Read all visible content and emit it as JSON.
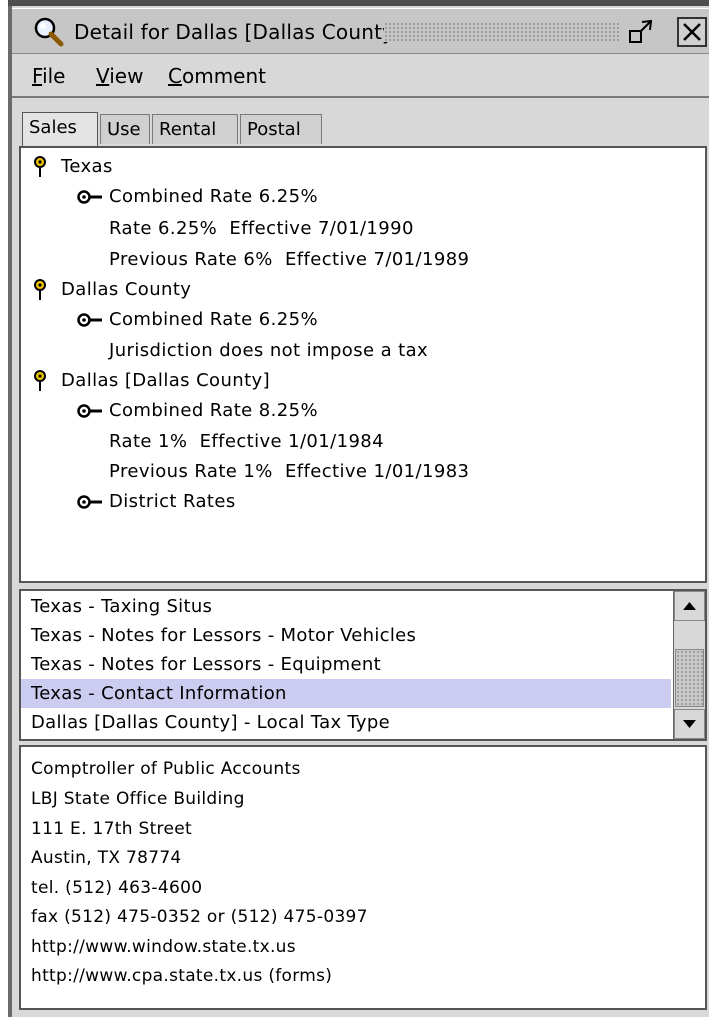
{
  "window": {
    "title": "Detail for Dallas [Dallas County]",
    "icon": "magnifier-icon",
    "buttons": [
      "restore-icon",
      "close-icon"
    ]
  },
  "menu": {
    "file": {
      "mnemonic": "F",
      "rest": "ile"
    },
    "view": {
      "mnemonic": "V",
      "rest": "iew"
    },
    "comment": {
      "mnemonic": "C",
      "rest": "omment"
    }
  },
  "tabs": [
    "Sales",
    "Use",
    "Rental",
    "Postal"
  ],
  "tree": [
    {
      "label": "Texas",
      "icon": "pin-icon"
    },
    {
      "label": "Combined Rate 6.25%",
      "icon": "key-icon"
    },
    {
      "label": "Rate 6.25%  Effective 7/01/1990"
    },
    {
      "label": "Previous Rate 6%  Effective 7/01/1989"
    },
    {
      "label": "Dallas County",
      "icon": "pin-icon"
    },
    {
      "label": "Combined Rate 6.25%",
      "icon": "key-icon"
    },
    {
      "label": "Jurisdiction does not impose a tax"
    },
    {
      "label": "Dallas [Dallas County]",
      "icon": "pin-icon"
    },
    {
      "label": "Combined Rate 8.25%",
      "icon": "key-icon"
    },
    {
      "label": "Rate 1%  Effective 1/01/1984"
    },
    {
      "label": "Previous Rate 1%  Effective 1/01/1983"
    },
    {
      "label": "District Rates",
      "icon": "key-icon"
    }
  ],
  "list": {
    "items": [
      "Texas - Taxing Situs",
      "Texas - Notes for Lessors - Motor Vehicles",
      "Texas - Notes for Lessors - Equipment",
      "Texas - Contact Information",
      "Dallas [Dallas County] - Local Tax Type"
    ],
    "selected_index": 3,
    "scroll_icons": [
      "arrow-up-icon",
      "arrow-down-icon"
    ]
  },
  "detail": [
    "Comptroller of Public Accounts",
    "LBJ State Office Building",
    "111 E. 17th Street",
    "Austin, TX 78774",
    "tel. (512) 463-4600",
    "fax (512) 475-0352 or (512) 475-0397",
    "http://www.window.state.tx.us",
    "http://www.cpa.state.tx.us (forms)"
  ],
  "colors": {
    "selection": "#ccccf0",
    "chrome": "#d8d8d8",
    "pin": "#c89b00"
  }
}
